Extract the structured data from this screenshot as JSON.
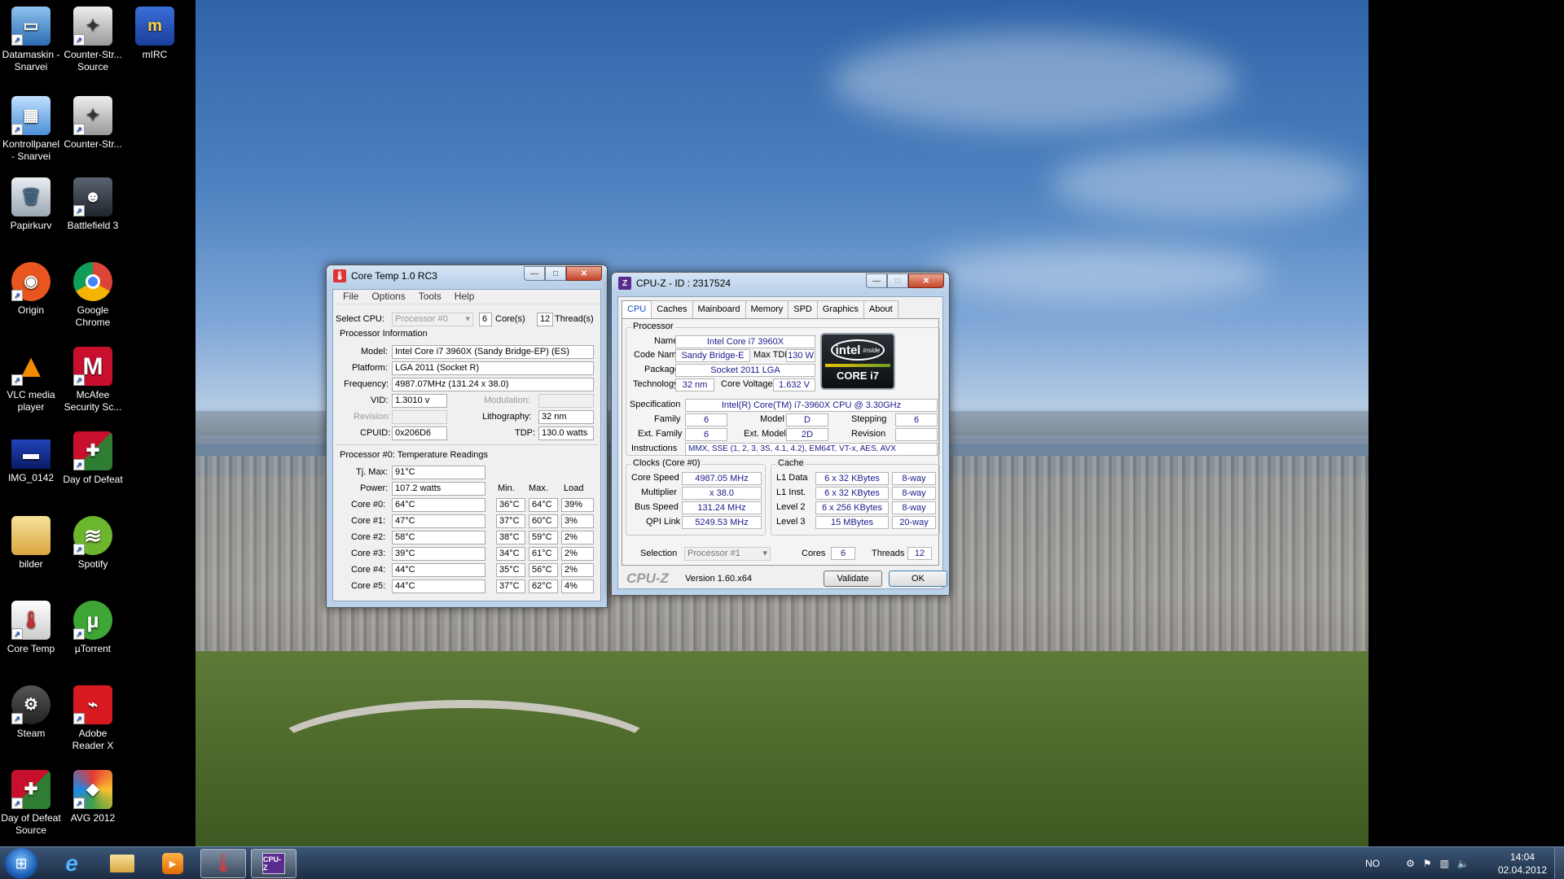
{
  "desktop_icons": [
    {
      "label": "Datamaskin - Snarvei"
    },
    {
      "label": "Counter-Str... Source"
    },
    {
      "label": "mIRC"
    },
    {
      "label": "Kontrollpanel - Snarvei"
    },
    {
      "label": "Counter-Str..."
    },
    {
      "label": "Papirkurv"
    },
    {
      "label": "Battlefield 3"
    },
    {
      "label": "Origin"
    },
    {
      "label": "Google Chrome"
    },
    {
      "label": "VLC media player"
    },
    {
      "label": "McAfee Security Sc..."
    },
    {
      "label": "IMG_0142"
    },
    {
      "label": "Day of Defeat"
    },
    {
      "label": "bilder"
    },
    {
      "label": "Spotify"
    },
    {
      "label": "Core Temp"
    },
    {
      "label": "µTorrent"
    },
    {
      "label": "Steam"
    },
    {
      "label": "Adobe Reader X"
    },
    {
      "label": "Day of Defeat Source"
    },
    {
      "label": "AVG 2012"
    }
  ],
  "coretemp": {
    "title": "Core Temp 1.0 RC3",
    "menu": [
      "File",
      "Options",
      "Tools",
      "Help"
    ],
    "select_cpu_label": "Select CPU:",
    "select_cpu_value": "Processor #0",
    "cores_value": "6",
    "cores_label": "Core(s)",
    "threads_value": "12",
    "threads_label": "Thread(s)",
    "proc_info_title": "Processor Information",
    "model_label": "Model:",
    "model": "Intel Core i7 3960X (Sandy Bridge-EP)  (ES)",
    "platform_label": "Platform:",
    "platform": "LGA 2011 (Socket R)",
    "frequency_label": "Frequency:",
    "frequency": "4987.07MHz (131.24 x 38.0)",
    "vid_label": "VID:",
    "vid": "1.3010 v",
    "modulation_label": "Modulation:",
    "revision_label": "Revision:",
    "lithography_label": "Lithography:",
    "lithography": "32 nm",
    "cpuid_label": "CPUID:",
    "cpuid": "0x206D6",
    "tdp_label": "TDP:",
    "tdp": "130.0 watts",
    "temps_title": "Processor #0: Temperature Readings",
    "tjmax_label": "Tj. Max:",
    "tjmax": "91°C",
    "power_label": "Power:",
    "power": "107.2 watts",
    "col_min": "Min.",
    "col_max": "Max.",
    "col_load": "Load",
    "cores": [
      {
        "name": "Core #0:",
        "temp": "64°C",
        "min": "36°C",
        "max": "64°C",
        "load": "39%"
      },
      {
        "name": "Core #1:",
        "temp": "47°C",
        "min": "37°C",
        "max": "60°C",
        "load": "3%"
      },
      {
        "name": "Core #2:",
        "temp": "58°C",
        "min": "38°C",
        "max": "59°C",
        "load": "2%"
      },
      {
        "name": "Core #3:",
        "temp": "39°C",
        "min": "34°C",
        "max": "61°C",
        "load": "2%"
      },
      {
        "name": "Core #4:",
        "temp": "44°C",
        "min": "35°C",
        "max": "56°C",
        "load": "2%"
      },
      {
        "name": "Core #5:",
        "temp": "44°C",
        "min": "37°C",
        "max": "62°C",
        "load": "4%"
      }
    ]
  },
  "cpuz": {
    "title": "CPU-Z - ID : 2317524",
    "tabs": [
      "CPU",
      "Caches",
      "Mainboard",
      "Memory",
      "SPD",
      "Graphics",
      "About"
    ],
    "processor_group": "Processor",
    "name_label": "Name",
    "name": "Intel Core i7 3960X",
    "codename_label": "Code Name",
    "codename": "Sandy Bridge-E",
    "maxtdp_label": "Max TDP",
    "maxtdp": "130 W",
    "package_label": "Package",
    "package": "Socket 2011 LGA",
    "technology_label": "Technology",
    "technology": "32 nm",
    "corevoltage_label": "Core Voltage",
    "corevoltage": "1.632 V",
    "spec_label": "Specification",
    "spec": "Intel(R) Core(TM) i7-3960X CPU @ 3.30GHz",
    "family_label": "Family",
    "family": "6",
    "model_label": "Model",
    "model": "D",
    "stepping_label": "Stepping",
    "stepping": "6",
    "extfamily_label": "Ext. Family",
    "extfamily": "6",
    "extmodel_label": "Ext. Model",
    "extmodel": "2D",
    "revision_label": "Revision",
    "revision": "",
    "instructions_label": "Instructions",
    "instructions": "MMX, SSE (1, 2, 3, 3S, 4.1, 4.2), EM64T, VT-x, AES, AVX",
    "logo_inside": "inside",
    "logo_brand": "intel",
    "logo_core": "CORE i7",
    "clocks_group": "Clocks (Core #0)",
    "corespeed_label": "Core Speed",
    "corespeed": "4987.05 MHz",
    "multiplier_label": "Multiplier",
    "multiplier": "x 38.0",
    "busspeed_label": "Bus Speed",
    "busspeed": "131.24 MHz",
    "qpi_label": "QPI Link",
    "qpi": "5249.53 MHz",
    "cache_group": "Cache",
    "cache": [
      {
        "label": "L1 Data",
        "size": "6 x 32 KBytes",
        "way": "8-way"
      },
      {
        "label": "L1 Inst.",
        "size": "6 x 32 KBytes",
        "way": "8-way"
      },
      {
        "label": "Level 2",
        "size": "6 x 256 KBytes",
        "way": "8-way"
      },
      {
        "label": "Level 3",
        "size": "15 MBytes",
        "way": "20-way"
      }
    ],
    "selection_label": "Selection",
    "selection": "Processor #1",
    "cores_label": "Cores",
    "cores": "6",
    "threads_label": "Threads",
    "threads": "12",
    "brand": "CPU-Z",
    "version": "Version 1.60.x64",
    "validate": "Validate",
    "ok": "OK"
  },
  "taskbar": {
    "lang": "NO",
    "time": "14:04",
    "date": "02.04.2012"
  }
}
